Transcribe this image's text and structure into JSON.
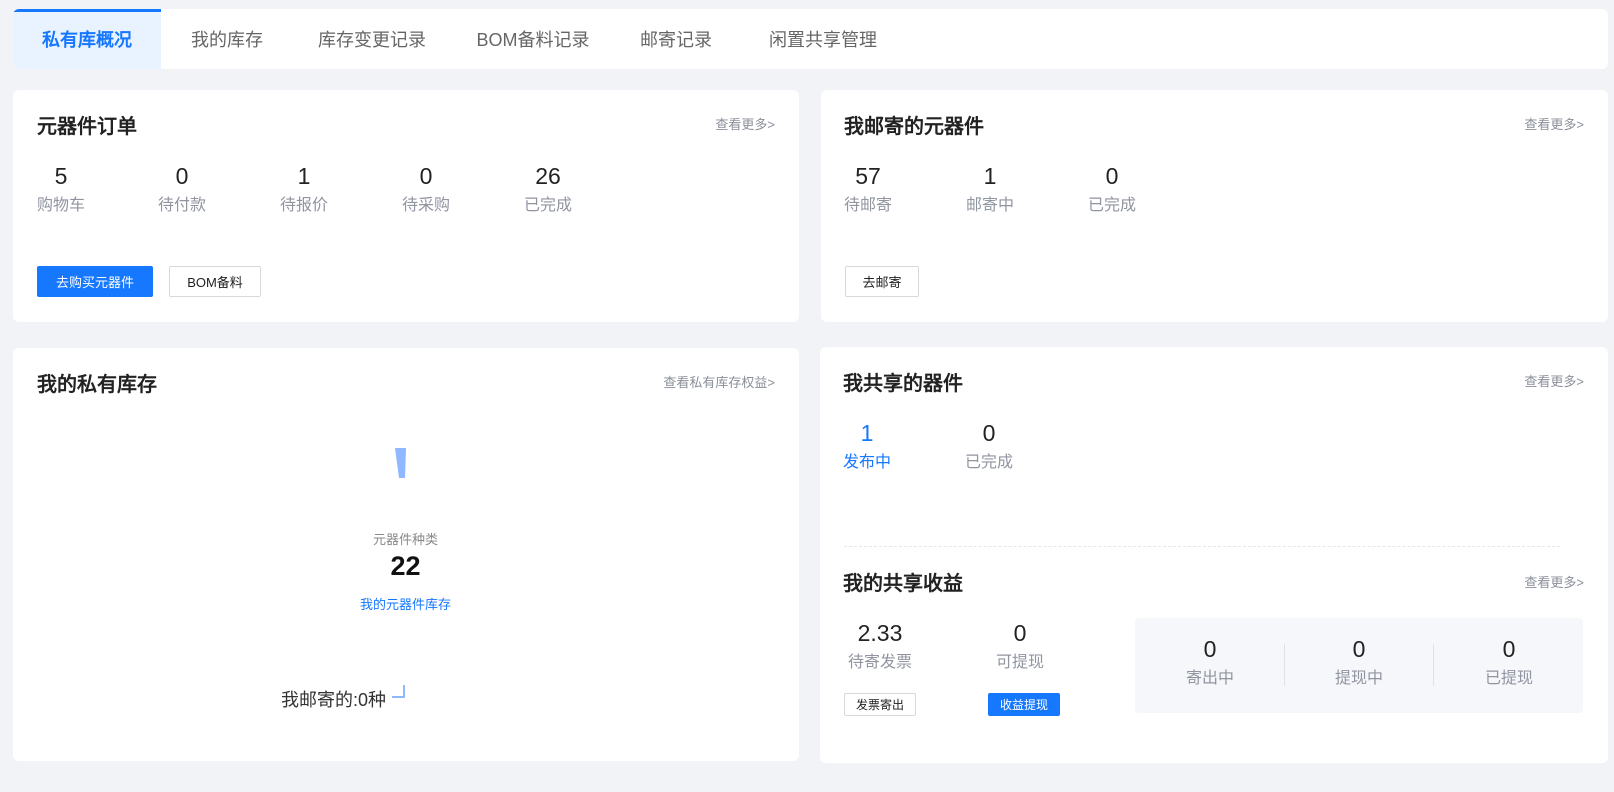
{
  "tabs": [
    {
      "label": "私有库概况",
      "active": true
    },
    {
      "label": "我的库存"
    },
    {
      "label": "库存变更记录"
    },
    {
      "label": "BOM备料记录"
    },
    {
      "label": "邮寄记录"
    },
    {
      "label": "闲置共享管理"
    }
  ],
  "orders": {
    "title": "元器件订单",
    "more": "查看更多>",
    "stats": [
      {
        "value": "5",
        "label": "购物车"
      },
      {
        "value": "0",
        "label": "待付款"
      },
      {
        "value": "1",
        "label": "待报价"
      },
      {
        "value": "0",
        "label": "待采购"
      },
      {
        "value": "26",
        "label": "已完成"
      }
    ],
    "buy_button": "去购买元器件",
    "bom_button": "BOM备料"
  },
  "mail": {
    "title": "我邮寄的元器件",
    "more": "查看更多>",
    "stats": [
      {
        "value": "57",
        "label": "待邮寄"
      },
      {
        "value": "1",
        "label": "邮寄中"
      },
      {
        "value": "0",
        "label": "已完成"
      }
    ],
    "send_button": "去邮寄"
  },
  "stock": {
    "title": "我的私有库存",
    "more": "查看私有库存权益>",
    "kind_label": "元器件种类",
    "kind_value": "22",
    "inventory_link": "我的元器件库存",
    "mailed_label": "我邮寄的:0种"
  },
  "shared": {
    "title": "我共享的器件",
    "more": "查看更多>",
    "stats": [
      {
        "value": "1",
        "label": "发布中"
      },
      {
        "value": "0",
        "label": "已完成"
      }
    ]
  },
  "earnings": {
    "title": "我的共享收益",
    "more": "查看更多>",
    "invoice_value": "2.33",
    "invoice_label": "待寄发票",
    "withdrawable_value": "0",
    "withdrawable_label": "可提现",
    "invoice_button": "发票寄出",
    "withdraw_button": "收益提现",
    "panel": [
      {
        "value": "0",
        "label": "寄出中"
      },
      {
        "value": "0",
        "label": "提现中"
      },
      {
        "value": "0",
        "label": "已提现"
      }
    ]
  },
  "colors": {
    "accent": "#1677ff",
    "chart_light": "#8fb8ff"
  }
}
